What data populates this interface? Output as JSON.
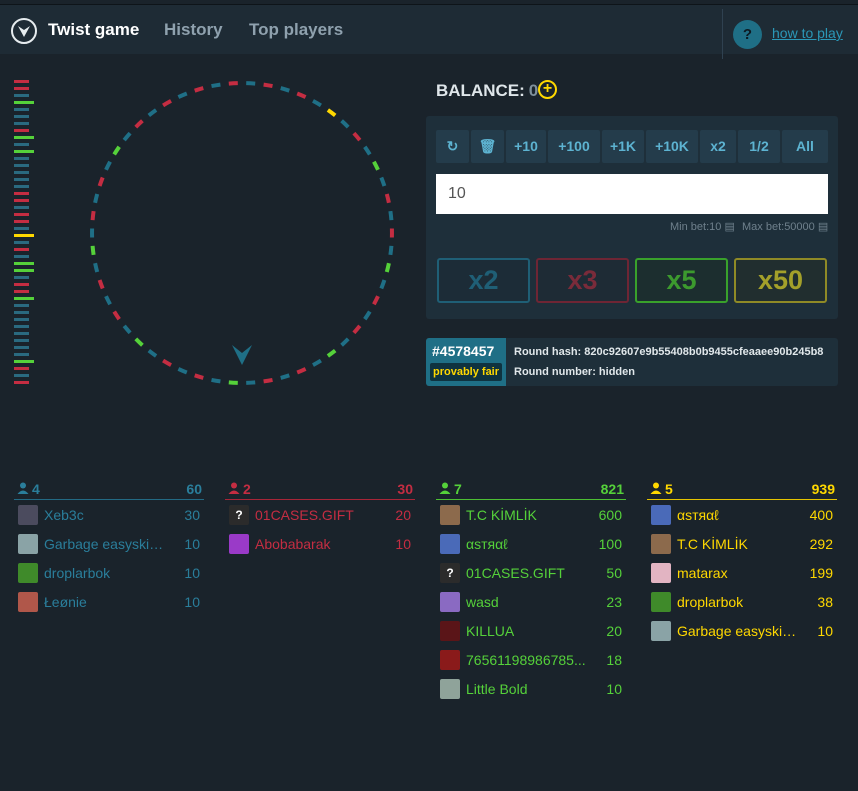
{
  "nav": {
    "logo_icon": "twist-logo-icon",
    "items": [
      "Twist game",
      "History",
      "Top players"
    ],
    "help_icon_text": "?",
    "help_link": "how to play"
  },
  "history_colors": [
    "#c42d42",
    "#c42d42",
    "#2a6a80",
    "#55d13a",
    "#2a6a80",
    "#2a6a80",
    "#2a6a80",
    "#c42d42",
    "#55d13a",
    "#2a6a80",
    "#55d13a",
    "#2a6a80",
    "#2a6a80",
    "#2a6a80",
    "#2a6a80",
    "#2a6a80",
    "#c42d42",
    "#c42d42",
    "#2a6a80",
    "#c42d42",
    "#c42d42",
    "#2a6a80",
    "#ffd800",
    "#2a6a80",
    "#c42d42",
    "#2a6a80",
    "#55d13a",
    "#55d13a",
    "#2a6a80",
    "#c42d42",
    "#c42d42",
    "#55d13a",
    "#2a6a80",
    "#2a6a80",
    "#2a6a80",
    "#2a6a80",
    "#2a6a80",
    "#2a6a80",
    "#2a6a80",
    "#2a6a80",
    "#55d13a",
    "#c42d42",
    "#2a6a80",
    "#c42d42"
  ],
  "wheel": {
    "colors": {
      "blue": "#1f6f86",
      "red": "#c42d42",
      "green": "#55d13a",
      "yellow": "#ffd800"
    },
    "pointer_icon": "pointer-arrow-icon"
  },
  "balance": {
    "label": "BALANCE:",
    "value": "0",
    "plus_icon": "+"
  },
  "bet": {
    "quick_buttons": [
      "↻",
      "🗑",
      "+10",
      "+100",
      "+1K",
      "+10K",
      "x2",
      "1/2",
      "All"
    ],
    "input_value": "10",
    "min_label": "Min bet:",
    "min_value": "10",
    "max_label": "Max bet:",
    "max_value": "50000",
    "multipliers": [
      {
        "label": "x2",
        "color": "#1f5f76",
        "text": "#1f5f76",
        "bg": "#1c2c37"
      },
      {
        "label": "x3",
        "color": "#6e2534",
        "text": "#7a2b3a",
        "bg": "#1e2b35"
      },
      {
        "label": "x5",
        "color": "#39a12b",
        "text": "#3c9a2e",
        "bg": "#1c2e2f"
      },
      {
        "label": "x50",
        "color": "#8f8a26",
        "text": "#a4a02a",
        "bg": "#212e2f"
      }
    ]
  },
  "round": {
    "id": "#4578457",
    "fair_label": "provably fair",
    "hash_label": "Round hash: 820c92607e9b55408b0b9455cfeaaee90b245b8",
    "number_label": "Round number: hidden"
  },
  "columns": [
    {
      "count": "4",
      "total": "60",
      "color": "#2a7e9b",
      "line": "#236a84",
      "players": [
        {
          "name": "Xeb3c",
          "amount": "30",
          "avatar_bg": "#4b4b5e",
          "avatar_icon": "player-avatar-icon"
        },
        {
          "name": "Garbage easyskins ...",
          "amount": "10",
          "avatar_bg": "#8aa3a6",
          "avatar_icon": "player-avatar-icon"
        },
        {
          "name": "droplarbok",
          "amount": "10",
          "avatar_bg": "#3f8a2a",
          "avatar_icon": "player-avatar-icon"
        },
        {
          "name": "Łeønie",
          "amount": "10",
          "avatar_bg": "#b0574a",
          "avatar_icon": "player-avatar-icon"
        }
      ]
    },
    {
      "count": "2",
      "total": "30",
      "color": "#c42d42",
      "line": "#a82538",
      "players": [
        {
          "name": "01CASES.GIFT",
          "amount": "20",
          "avatar_bg": "#2b2b2b",
          "avatar_icon": "?"
        },
        {
          "name": "Abobabarak",
          "amount": "10",
          "avatar_bg": "#9a3ac8",
          "avatar_icon": "player-avatar-icon"
        }
      ]
    },
    {
      "count": "7",
      "total": "821",
      "color": "#55d13a",
      "line": "#4dbf34",
      "players": [
        {
          "name": "T.C KİMLİK",
          "amount": "600",
          "avatar_bg": "#8c6a4c",
          "avatar_icon": "player-avatar-icon"
        },
        {
          "name": "αѕтяαℓ",
          "amount": "100",
          "avatar_bg": "#4a6ab8",
          "avatar_icon": "player-avatar-icon"
        },
        {
          "name": "01CASES.GIFT",
          "amount": "50",
          "avatar_bg": "#2b2b2b",
          "avatar_icon": "?"
        },
        {
          "name": "wasd",
          "amount": "23",
          "avatar_bg": "#8a6ac2",
          "avatar_icon": "player-avatar-icon"
        },
        {
          "name": "KILLUA",
          "amount": "20",
          "avatar_bg": "#5a1518",
          "avatar_icon": "player-avatar-icon"
        },
        {
          "name": "76561198986785...",
          "amount": "18",
          "avatar_bg": "#8a1a1a",
          "avatar_icon": "player-avatar-icon"
        },
        {
          "name": "Little Bold",
          "amount": "10",
          "avatar_bg": "#8fa39a",
          "avatar_icon": "player-avatar-icon"
        }
      ]
    },
    {
      "count": "5",
      "total": "939",
      "color": "#ffd800",
      "line": "#e5c400",
      "players": [
        {
          "name": "αѕтяαℓ",
          "amount": "400",
          "avatar_bg": "#4a6ab8",
          "avatar_icon": "player-avatar-icon"
        },
        {
          "name": "T.C KİMLİK",
          "amount": "292",
          "avatar_bg": "#8c6a4c",
          "avatar_icon": "player-avatar-icon"
        },
        {
          "name": "matarax",
          "amount": "199",
          "avatar_bg": "#e2b4c2",
          "avatar_icon": "player-avatar-icon"
        },
        {
          "name": "droplarbok",
          "amount": "38",
          "avatar_bg": "#3f8a2a",
          "avatar_icon": "player-avatar-icon"
        },
        {
          "name": "Garbage easyskins ...",
          "amount": "10",
          "avatar_bg": "#8aa3a6",
          "avatar_icon": "player-avatar-icon"
        }
      ]
    }
  ]
}
